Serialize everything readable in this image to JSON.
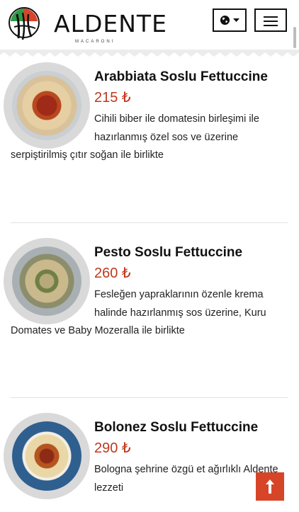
{
  "brand": {
    "name": "ALDENTE",
    "tagline": "MACARONI"
  },
  "header": {
    "language_icon": "globe-icon",
    "language_caret": "caret-down-icon",
    "menu_icon": "hamburger-menu-icon"
  },
  "colors": {
    "price": "#c0391c",
    "scroll_top_button": "#d64527",
    "plate": "#d9d9d9"
  },
  "menu_items": [
    {
      "title": "Arabbiata Soslu Fettuccine",
      "price": "215 ₺",
      "description": "Cihili biber ile domatesin birleşimi ile hazırlanmış özel sos ve üzerine serpiştirilmiş çıtır soğan ile birlikte"
    },
    {
      "title": "Pesto Soslu Fettuccine",
      "price": "260 ₺",
      "description": "Fesleğen yapraklarının özenle krema halinde hazırlanmış sos üzerine, Kuru Domates ve Baby Mozeralla ile birlikte"
    },
    {
      "title": "Bolonez Soslu Fettuccine",
      "price": "290 ₺",
      "description": "Bologna şehrine özgü et ağırlıklı Aldente lezzeti"
    }
  ],
  "scroll_top": {
    "icon": "arrow-up-icon",
    "glyph": "↑"
  }
}
